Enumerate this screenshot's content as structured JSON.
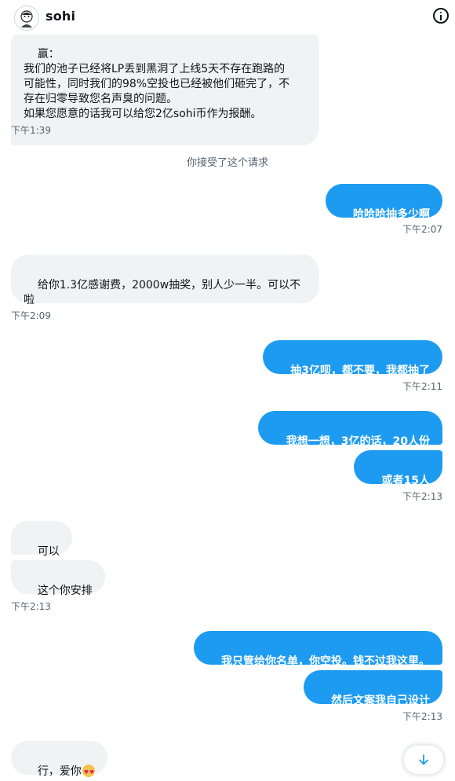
{
  "header": {
    "name": "sohi"
  },
  "messages": {
    "m1": {
      "text": "赢：\n我们的池子已经将LP丢到黑洞了上线5天不存在跑路的\n可能性，同时我们的98%空投也已经被他们砸完了，不\n存在归零导致您名声臭的问题。\n如果您愿意的话我可以给您2亿sohi币作为报酬。",
      "time": "下午1:39"
    },
    "system": "你接受了这个请求",
    "m2": {
      "text": "哈哈哈抽多少啊",
      "time": "下午2:07"
    },
    "m3": {
      "text": "给你1.3亿感谢费，2000w抽奖，别人少一半。可以不\n啦",
      "time": "下午2:09"
    },
    "m4": {
      "text": "抽3亿呗，都不要，我都抽了",
      "time": "下午2:11"
    },
    "m5": {
      "text": "我想一想，3亿的话，20人份"
    },
    "m6": {
      "text": "或者15人",
      "time": "下午2:13"
    },
    "m7": {
      "text": "可以"
    },
    "m8": {
      "text": "这个你安排",
      "time": "下午2:13"
    },
    "m9": {
      "text": "我只管给你名单，你空投。钱不过我这里。"
    },
    "m10": {
      "text": "然后文案我自己设计",
      "time": "下午2:13"
    },
    "m11": {
      "text": "行，爱你",
      "emoji": "heart-eyes-emoji"
    }
  },
  "icons": {
    "info": "info-icon",
    "scroll": "arrow-down-icon"
  },
  "colors": {
    "outgoing": "#1d9bf0",
    "incoming": "#eff3f4",
    "timestamp": "#536471"
  }
}
